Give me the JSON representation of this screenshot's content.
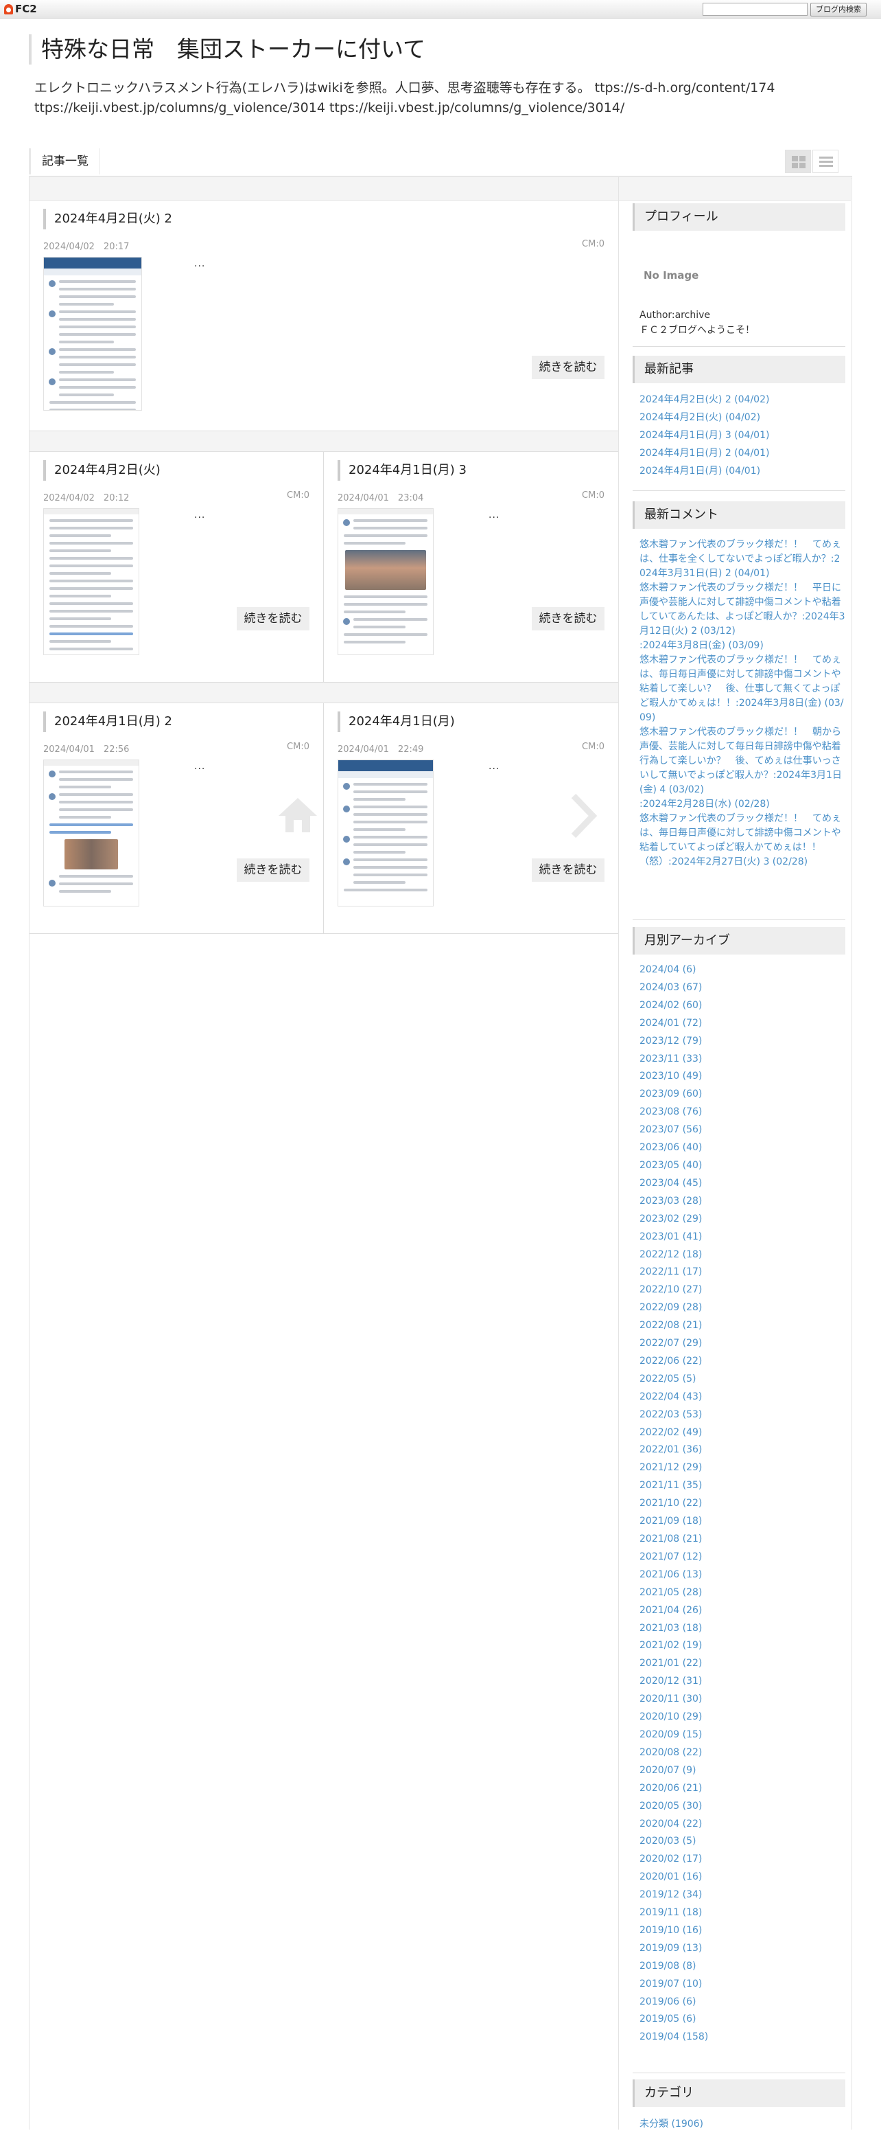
{
  "fc2bar": {
    "logo_text": "FC2",
    "search_button": "ブログ内検索",
    "search_value": ""
  },
  "blog": {
    "title": "特殊な日常　集団ストーカーに付いて",
    "description": "エレクトロニックハラスメント行為(エレハラ)はwikiを参照。人口夢、思考盗聴等も存在する。 ttps://s-d-h.org/content/174 ttps://keiji.vbest.jp/columns/g_violence/3014 ttps://keiji.vbest.jp/columns/g_violence/3014/"
  },
  "nav": {
    "tab_label": "記事一覧"
  },
  "entries": [
    {
      "title": "2024年4月2日(火) 2",
      "date": "2024/04/02　20:17",
      "cm": "CM:0",
      "dots": "...",
      "more": "続きを読む",
      "thumb_icon": "sns-screenshot-thumbnail"
    },
    {
      "title": "2024年4月2日(火)",
      "date": "2024/04/02　20:12",
      "cm": "CM:0",
      "dots": "...",
      "more": "続きを読む",
      "thumb_icon": "sns-screenshot-thumbnail"
    },
    {
      "title": "2024年4月1日(月) 3",
      "date": "2024/04/01　23:04",
      "cm": "CM:0",
      "dots": "...",
      "more": "続きを読む",
      "thumb_icon": "sns-screenshot-photo-thumbnail"
    },
    {
      "title": "2024年4月1日(月) 2",
      "date": "2024/04/01　22:56",
      "cm": "CM:0",
      "dots": "...",
      "more": "続きを読む",
      "thumb_icon": "sns-screenshot-photo-thumbnail"
    },
    {
      "title": "2024年4月1日(月)",
      "date": "2024/04/01　22:49",
      "cm": "CM:0",
      "dots": "...",
      "more": "続きを読む",
      "thumb_icon": "sns-screenshot-thumbnail"
    }
  ],
  "pager": {
    "home_icon": "home-icon",
    "next_icon": "chevron-right-icon"
  },
  "sidebar": {
    "profile": {
      "heading": "プロフィール",
      "no_image": "No Image",
      "author": "Author:archive",
      "welcome": "ＦＣ２ブログへようこそ！"
    },
    "recent_posts": {
      "heading": "最新記事",
      "items": [
        "2024年4月2日(火) 2 (04/02)",
        "2024年4月2日(火) (04/02)",
        "2024年4月1日(月) 3 (04/01)",
        "2024年4月1日(月) 2 (04/01)",
        "2024年4月1日(月) (04/01)"
      ]
    },
    "recent_comments": {
      "heading": "最新コメント",
      "items": [
        "悠木碧ファン代表のブラック様だ！！　てめぇは、仕事を全くしてないでよっぽど暇人か？:2024年3月31日(日) 2 (04/01)",
        "悠木碧ファン代表のブラック様だ！！　平日に声優や芸能人に対して誹謗中傷コメントや粘着していてあんたは、よっぽど暇人か？:2024年3月12日(火) 2 (03/12)",
        ":2024年3月8日(金) (03/09)",
        "悠木碧ファン代表のブラック様だ！！　てめぇは、毎日毎日声優に対して誹謗中傷コメントや粘着して楽しい？　後、仕事して無くてよっぽど暇人かてめぇは！！:2024年3月8日(金) (03/09)",
        "悠木碧ファン代表のブラック様だ！！　朝から声優、芸能人に対して毎日毎日誹謗中傷や粘着行為して楽しいか？　後、てめぇは仕事いっさいして無いでよっぽど暇人か？:2024年3月1日(金) 4 (03/02)",
        ":2024年2月28日(水) (02/28)",
        "悠木碧ファン代表のブラック様だ！！　てめぇは、毎日毎日声優に対して誹謗中傷コメントや粘着していてよっぽど暇人かてめぇは！！（怒）:2024年2月27日(火) 3 (02/28)"
      ]
    },
    "archives": {
      "heading": "月別アーカイブ",
      "items": [
        "2024/04 (6)",
        "2024/03 (67)",
        "2024/02 (60)",
        "2024/01 (72)",
        "2023/12 (79)",
        "2023/11 (33)",
        "2023/10 (49)",
        "2023/09 (60)",
        "2023/08 (76)",
        "2023/07 (56)",
        "2023/06 (40)",
        "2023/05 (40)",
        "2023/04 (45)",
        "2023/03 (28)",
        "2023/02 (29)",
        "2023/01 (41)",
        "2022/12 (18)",
        "2022/11 (17)",
        "2022/10 (27)",
        "2022/09 (28)",
        "2022/08 (21)",
        "2022/07 (29)",
        "2022/06 (22)",
        "2022/05 (5)",
        "2022/04 (43)",
        "2022/03 (53)",
        "2022/02 (49)",
        "2022/01 (36)",
        "2021/12 (29)",
        "2021/11 (35)",
        "2021/10 (22)",
        "2021/09 (18)",
        "2021/08 (21)",
        "2021/07 (12)",
        "2021/06 (13)",
        "2021/05 (28)",
        "2021/04 (26)",
        "2021/03 (18)",
        "2021/02 (19)",
        "2021/01 (22)",
        "2020/12 (31)",
        "2020/11 (30)",
        "2020/10 (29)",
        "2020/09 (15)",
        "2020/08 (22)",
        "2020/07 (9)",
        "2020/06 (21)",
        "2020/05 (30)",
        "2020/04 (22)",
        "2020/03 (5)",
        "2020/02 (17)",
        "2020/01 (16)",
        "2019/12 (34)",
        "2019/11 (18)",
        "2019/10 (16)",
        "2019/09 (13)",
        "2019/08 (8)",
        "2019/07 (10)",
        "2019/06 (6)",
        "2019/05 (6)",
        "2019/04 (158)"
      ]
    },
    "categories": {
      "heading": "カテゴリ",
      "items": [
        "未分類 (1906)"
      ]
    }
  }
}
